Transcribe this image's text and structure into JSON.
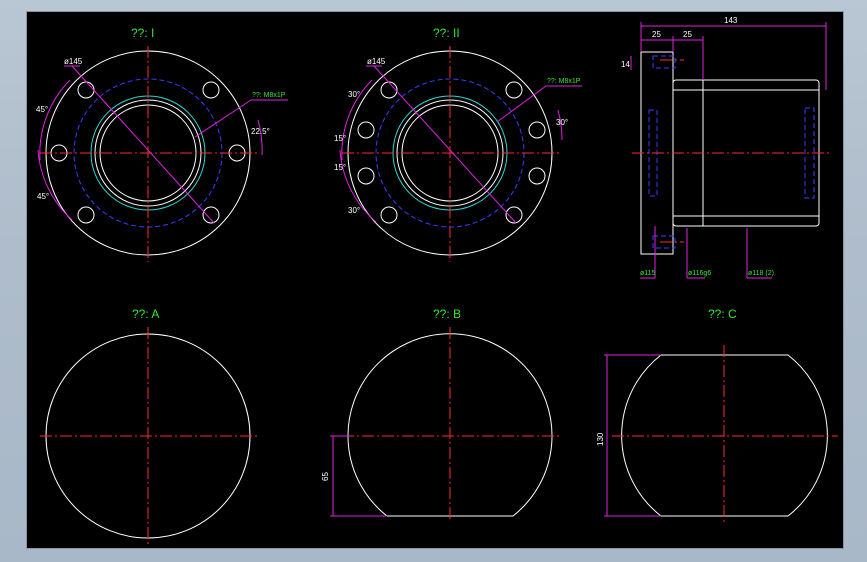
{
  "drawing": {
    "colors": {
      "background": "#000000",
      "outline": "#ffffff",
      "centerline": "#ff2a2a",
      "hidden": "#3b3bff",
      "thread": "#2fd6d6",
      "dimension": "#e020e0",
      "label": "#2ee82e"
    },
    "views": {
      "view1": {
        "title": "??: I",
        "dia": "ø145",
        "angle_a": "45°",
        "angle_b": "45°",
        "angle_c": "22.5°",
        "thread": "??: M8x1P"
      },
      "view2": {
        "title": "??: II",
        "dia": "ø145",
        "angle_a": "30°",
        "angle_b": "15°",
        "angle_c": "15°",
        "angle_d": "30°",
        "angle_e": "30°",
        "thread": "??: M8x1P"
      },
      "side": {
        "overall": "143",
        "w1": "25",
        "w2": "25",
        "h1": "14",
        "d1": "ø115",
        "d2": "ø116g6",
        "d3": "ø118 (2)"
      },
      "viewA": {
        "title": "??: A"
      },
      "viewB": {
        "title": "??: B",
        "dim": "65"
      },
      "viewC": {
        "title": "??: C",
        "dim": "130"
      }
    }
  }
}
